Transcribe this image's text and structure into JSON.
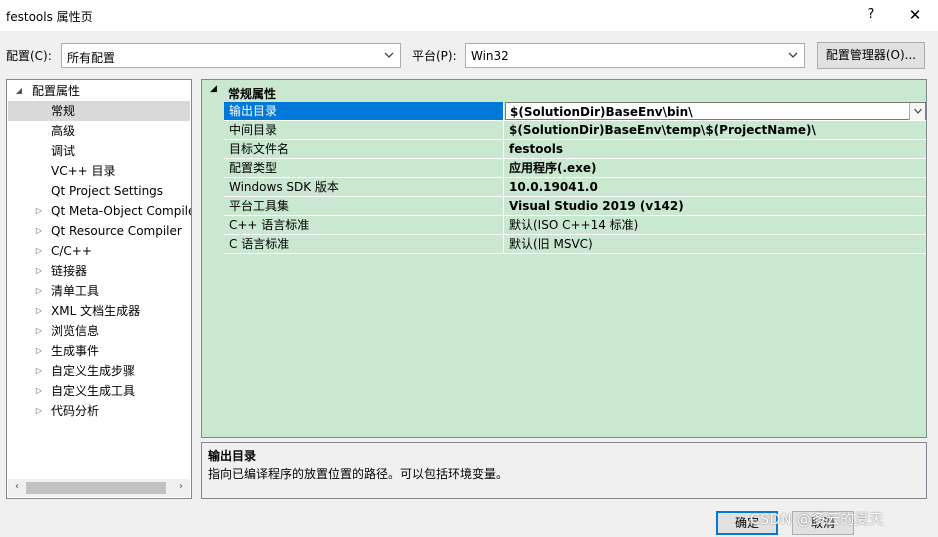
{
  "window": {
    "title": "festools 属性页",
    "help_glyph": "?",
    "close_glyph": "✕"
  },
  "toolbar": {
    "config_label": "配置(C):",
    "config_value": "所有配置",
    "platform_label": "平台(P):",
    "platform_value": "Win32",
    "config_manager_label": "配置管理器(O)..."
  },
  "tree": {
    "root": "配置属性",
    "items": [
      {
        "label": "常规",
        "expandable": false,
        "selected": true
      },
      {
        "label": "高级",
        "expandable": false
      },
      {
        "label": "调试",
        "expandable": false
      },
      {
        "label": "VC++ 目录",
        "expandable": false
      },
      {
        "label": "Qt Project Settings",
        "expandable": false
      },
      {
        "label": "Qt Meta-Object Compile",
        "expandable": true
      },
      {
        "label": "Qt Resource Compiler",
        "expandable": true
      },
      {
        "label": "C/C++",
        "expandable": true
      },
      {
        "label": "链接器",
        "expandable": true
      },
      {
        "label": "清单工具",
        "expandable": true
      },
      {
        "label": "XML 文档生成器",
        "expandable": true
      },
      {
        "label": "浏览信息",
        "expandable": true
      },
      {
        "label": "生成事件",
        "expandable": true
      },
      {
        "label": "自定义生成步骤",
        "expandable": true
      },
      {
        "label": "自定义生成工具",
        "expandable": true
      },
      {
        "label": "代码分析",
        "expandable": true
      }
    ]
  },
  "grid": {
    "category": "常规属性",
    "rows": [
      {
        "name": "输出目录",
        "value": "$(SolutionDir)BaseEnv\\bin\\"
      },
      {
        "name": "中间目录",
        "value": "$(SolutionDir)BaseEnv\\temp\\$(ProjectName)\\"
      },
      {
        "name": "目标文件名",
        "value": "festools"
      },
      {
        "name": "配置类型",
        "value": "应用程序(.exe)"
      },
      {
        "name": "Windows SDK 版本",
        "value": "10.0.19041.0"
      },
      {
        "name": "平台工具集",
        "value": "Visual Studio 2019 (v142)"
      },
      {
        "name": "C++ 语言标准",
        "value": "默认(ISO C++14 标准)"
      },
      {
        "name": "C 语言标准",
        "value": "默认(旧 MSVC)"
      }
    ]
  },
  "description": {
    "title": "输出目录",
    "text": "指向已编译程序的放置位置的路径。可以包括环境变量。"
  },
  "buttons": {
    "ok": "确定",
    "cancel": "取消"
  },
  "watermark": "CSDN @多云的夏天"
}
